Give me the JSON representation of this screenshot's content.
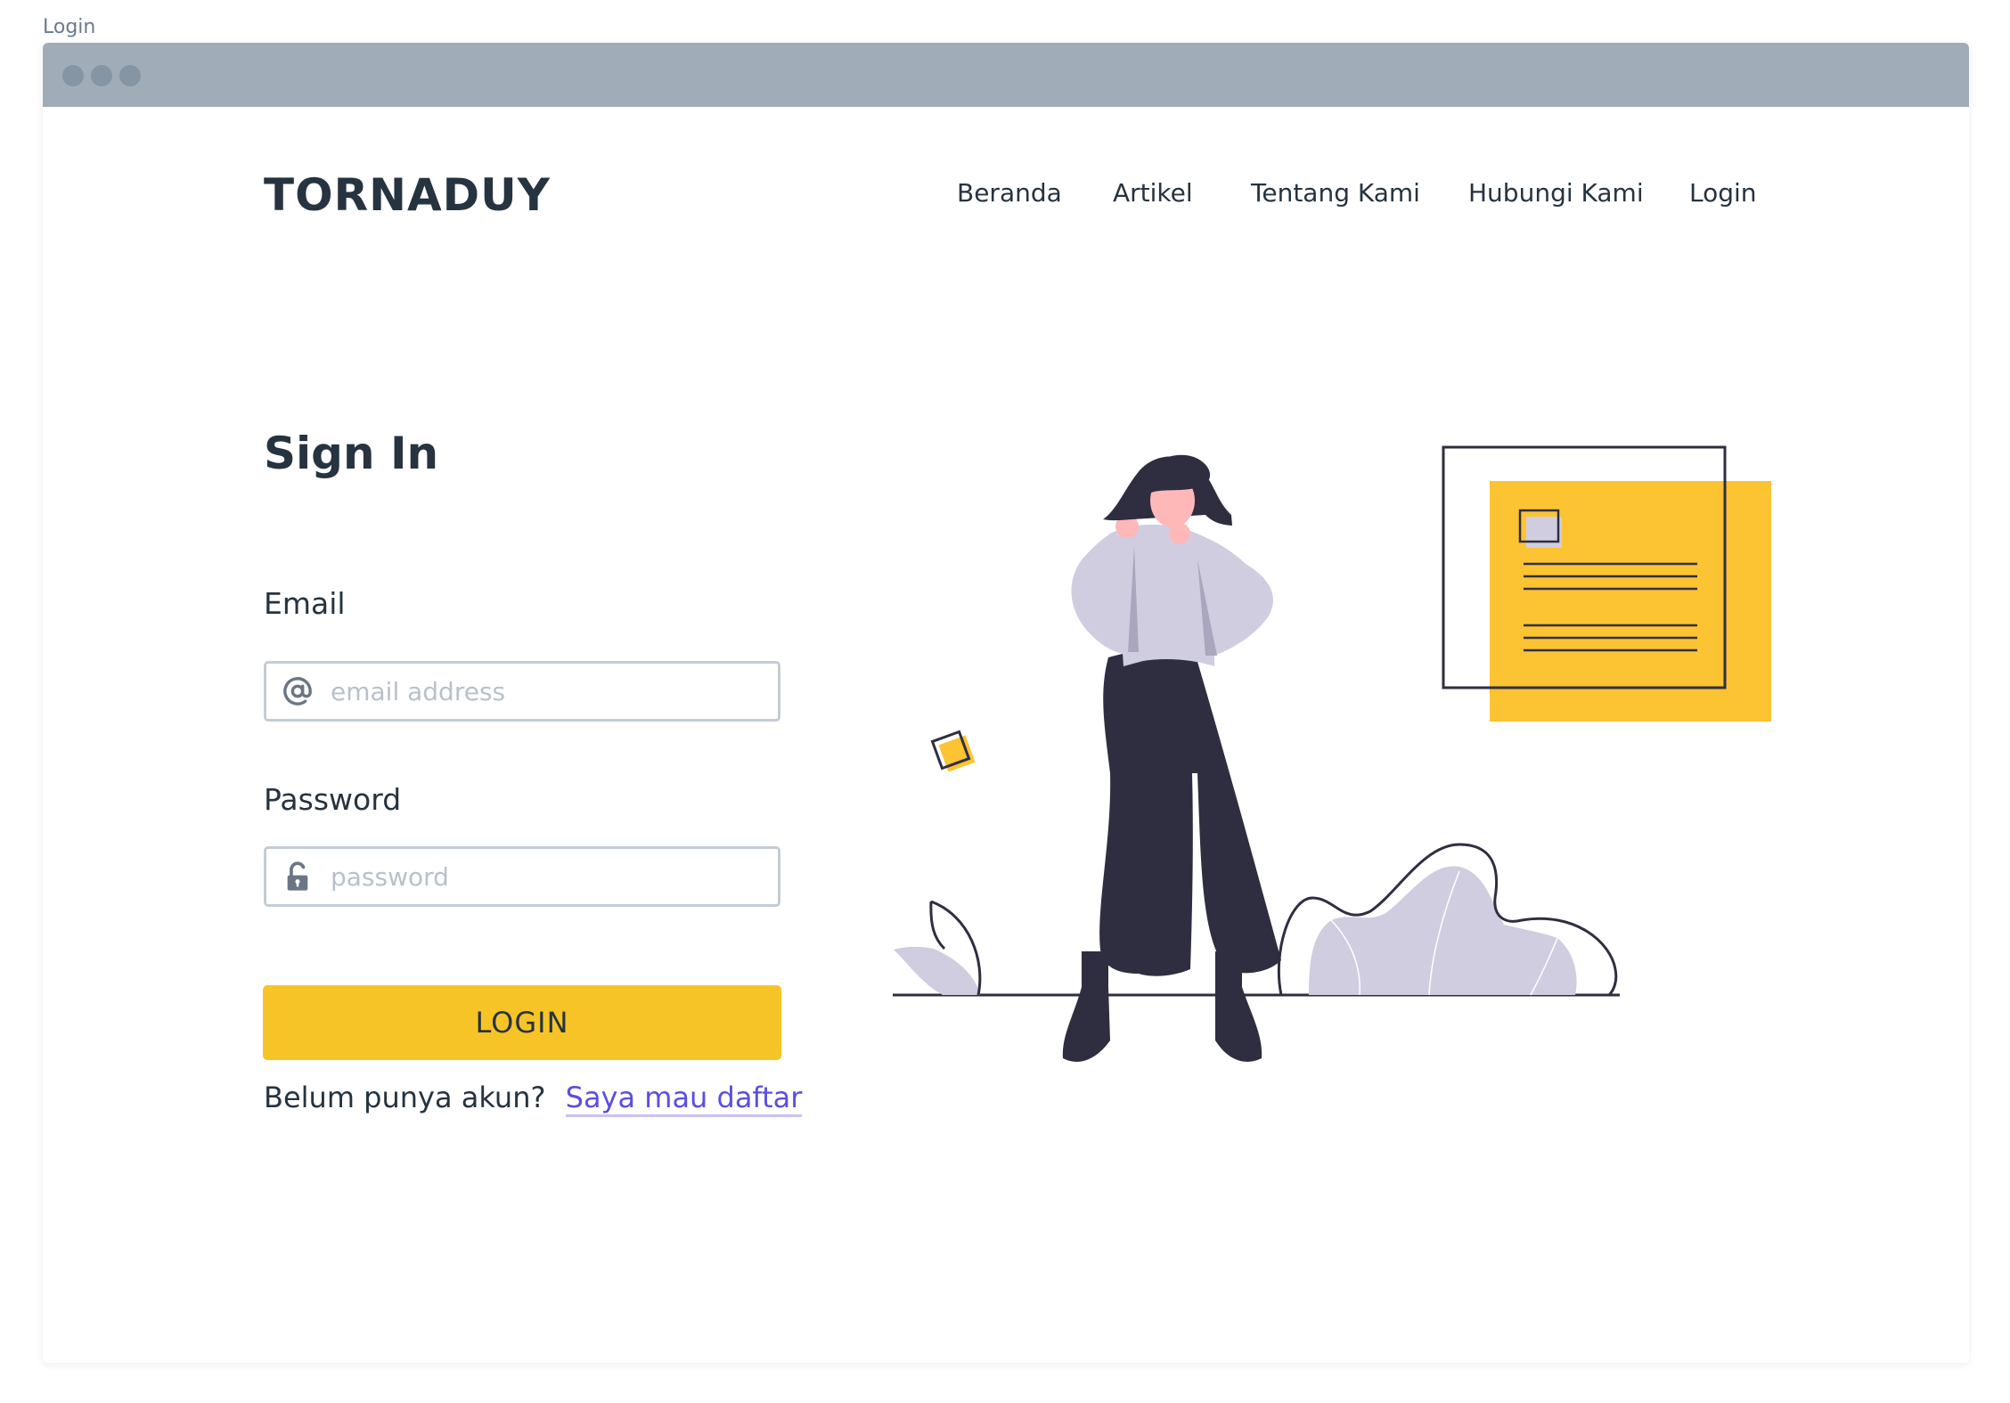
{
  "page": {
    "caption": "Login"
  },
  "window": {
    "dots": [
      "dot",
      "dot",
      "dot"
    ]
  },
  "header": {
    "brand": "TORNADUY",
    "nav": [
      {
        "label": "Beranda"
      },
      {
        "label": "Artikel"
      },
      {
        "label": "Tentang Kami"
      },
      {
        "label": "Hubungi Kami"
      },
      {
        "label": "Login"
      }
    ]
  },
  "form": {
    "title": "Sign In",
    "email": {
      "label": "Email",
      "placeholder": "email address",
      "value": "",
      "icon": "at-sign-icon"
    },
    "password": {
      "label": "Password",
      "placeholder": "password",
      "value": "",
      "icon": "unlock-icon"
    },
    "submit_label": "LOGIN",
    "signup_prompt": "Belum punya akun?",
    "signup_link": "Saya mau daftar"
  },
  "colors": {
    "primary": "#f7c427",
    "text": "#263340",
    "link": "#5b4fe0",
    "titlebar": "#a0adb9",
    "input_border": "#c4ccd6",
    "illustration_dark": "#2f2e41",
    "illustration_lavender": "#d0cde1",
    "illustration_skin": "#ffb8b8",
    "illustration_yellow": "#fcc332"
  }
}
